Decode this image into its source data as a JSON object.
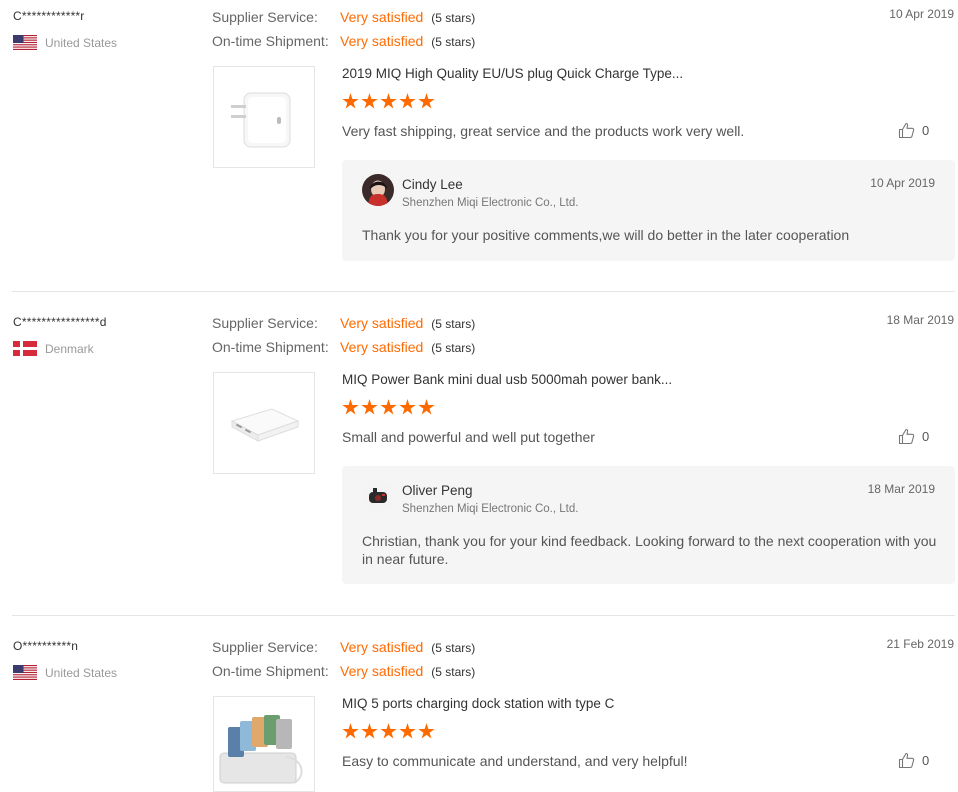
{
  "reviews": [
    {
      "buyer": "C************r",
      "country": "United States",
      "supplier_label": "Supplier Service:",
      "supplier_value": "Very satisfied",
      "supplier_stars": "(5 stars)",
      "shipment_label": "On-time Shipment:",
      "shipment_value": "Very satisfied",
      "shipment_stars": "(5 stars)",
      "date": "10 Apr 2019",
      "product": "2019 MIQ High Quality EU/US plug Quick Charge Type...",
      "rating": 5,
      "comment": "Very fast shipping, great service and the products work very well.",
      "likes": "0",
      "reply": {
        "name": "Cindy Lee",
        "company": "Shenzhen Miqi Electronic Co., Ltd.",
        "date": "10 Apr 2019",
        "text": "Thank you for your positive comments,we will do better in the later cooperation"
      }
    },
    {
      "buyer": "C****************d",
      "country": "Denmark",
      "supplier_label": "Supplier Service:",
      "supplier_value": "Very satisfied",
      "supplier_stars": "(5 stars)",
      "shipment_label": "On-time Shipment:",
      "shipment_value": "Very satisfied",
      "shipment_stars": "(5 stars)",
      "date": "18 Mar 2019",
      "product": "MIQ Power Bank mini dual usb 5000mah power bank...",
      "rating": 5,
      "comment": "Small and powerful and well put together",
      "likes": "0",
      "reply": {
        "name": "Oliver Peng",
        "company": "Shenzhen Miqi Electronic Co., Ltd.",
        "date": "18 Mar 2019",
        "text": "Christian, thank you for your kind feedback. Looking forward to the next cooperation with you in near future."
      }
    },
    {
      "buyer": "O**********n",
      "country": "United States",
      "supplier_label": "Supplier Service:",
      "supplier_value": "Very satisfied",
      "supplier_stars": "(5 stars)",
      "shipment_label": "On-time Shipment:",
      "shipment_value": "Very satisfied",
      "shipment_stars": "(5 stars)",
      "date": "21 Feb 2019",
      "product": "MIQ 5 ports charging dock station with type C",
      "rating": 5,
      "comment": "Easy to communicate and understand, and very helpful!",
      "likes": "0"
    }
  ],
  "colors": {
    "accent": "#ff6a00",
    "divider": "#e5e5e5",
    "reply_bg": "#f5f5f5"
  },
  "icons": {
    "like": "thumbs-up-icon",
    "flag_us": "us-flag-icon",
    "flag_dk": "denmark-flag-icon"
  }
}
